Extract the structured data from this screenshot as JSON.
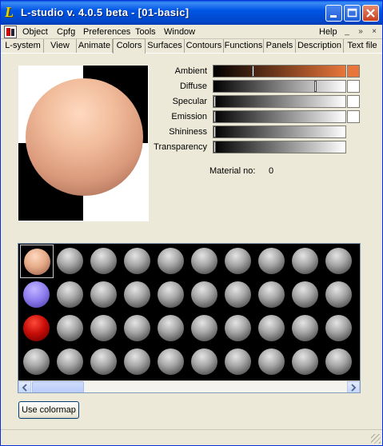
{
  "window": {
    "title": "L-studio v. 4.0.5 beta - [01-basic]",
    "logo_letter": "L"
  },
  "menu": {
    "items": [
      "Object",
      "Cpfg",
      "Preferences",
      "Tools",
      "Window"
    ],
    "help": "Help",
    "mdi_controls": [
      "_",
      "»",
      "×"
    ]
  },
  "tabs": [
    "L-system",
    "View",
    "Animate",
    "Colors",
    "Surfaces",
    "Contours",
    "Functions",
    "Panels",
    "Description",
    "Text file"
  ],
  "active_tab": "Colors",
  "material": {
    "properties": [
      {
        "label": "Ambient",
        "level": 0.3,
        "swatch": "#e8763a",
        "gradient_end": "#e8763a"
      },
      {
        "label": "Diffuse",
        "level": 0.79,
        "swatch": "#ffffff",
        "gradient_end": "#ffffff"
      },
      {
        "label": "Specular",
        "level": 0.0,
        "swatch": "#ffffff",
        "gradient_end": "#ffffff"
      },
      {
        "label": "Emission",
        "level": 0.0,
        "swatch": "#ffffff",
        "gradient_end": "#ffffff"
      },
      {
        "label": "Shininess",
        "level": 0.0,
        "swatch": null,
        "gradient_end": "#ffffff"
      },
      {
        "label": "Transparency",
        "level": 0.0,
        "swatch": null,
        "gradient_end": "#ffffff"
      }
    ],
    "number_label": "Material no:",
    "number_value": "0"
  },
  "palette": {
    "columns": 10,
    "rows": 4,
    "selected_index": 0,
    "special_colors": {
      "0": "peach",
      "10": "lavender",
      "20": "red"
    },
    "default_color": "grey"
  },
  "buttons": {
    "use_colormap": "Use colormap"
  },
  "colors": {
    "titlebar": "#0055e5",
    "window_bg": "#ece9d8",
    "ambient_orange": "#e8763a"
  }
}
